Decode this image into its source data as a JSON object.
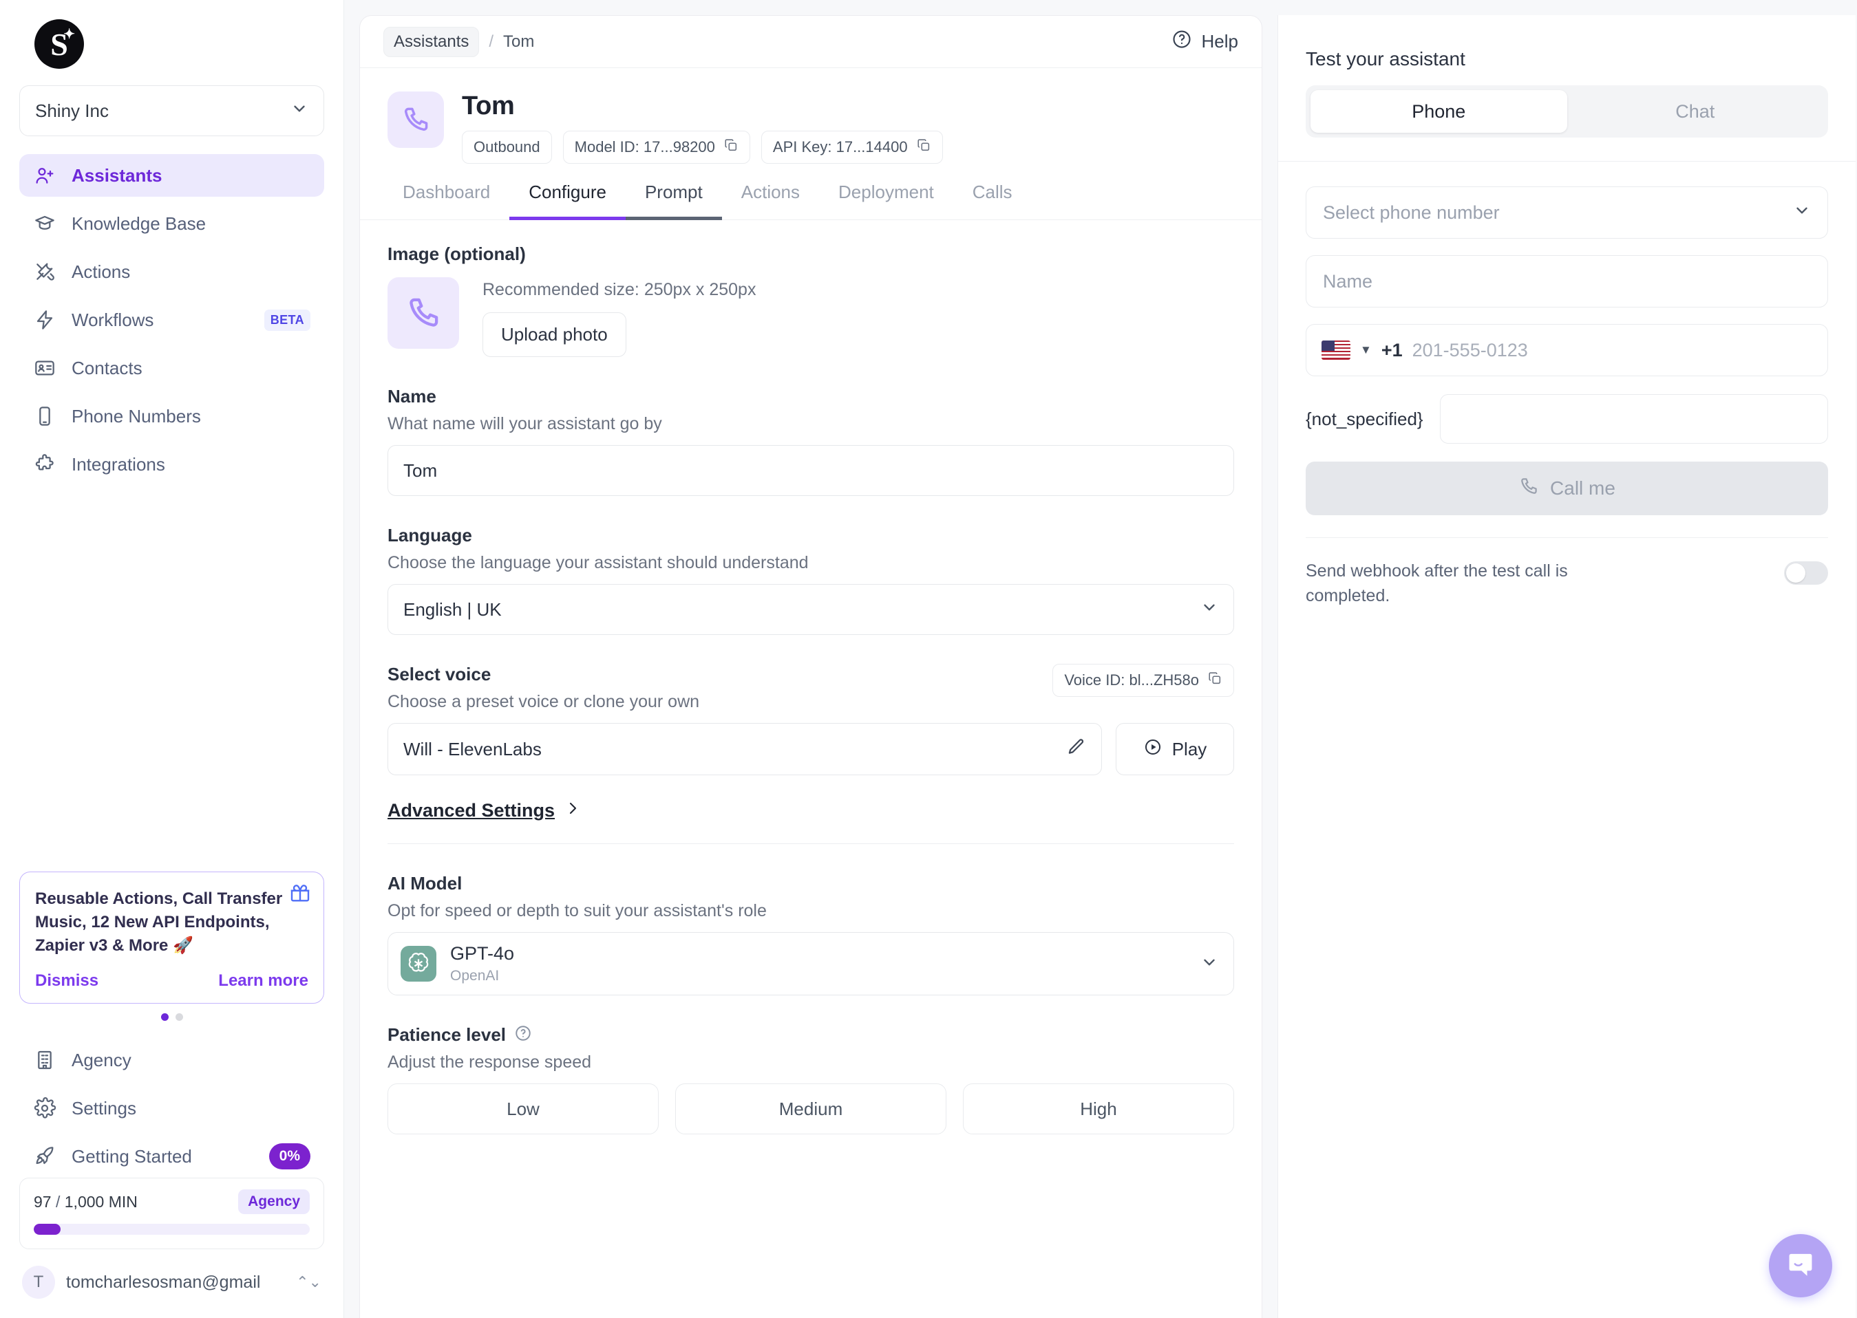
{
  "brand": {
    "logo_letter": "S",
    "accent": "#7c3aed",
    "accent_dark": "#6d28d9"
  },
  "sidebar": {
    "org": {
      "name": "Shiny Inc"
    },
    "nav": [
      {
        "label": "Assistants",
        "icon": "user-plus-icon",
        "active": true
      },
      {
        "label": "Knowledge Base",
        "icon": "graduation-cap-icon",
        "active": false
      },
      {
        "label": "Actions",
        "icon": "tools-icon",
        "active": false
      },
      {
        "label": "Workflows",
        "icon": "bolt-icon",
        "active": false,
        "badge": "BETA"
      },
      {
        "label": "Contacts",
        "icon": "contact-card-icon",
        "active": false
      },
      {
        "label": "Phone Numbers",
        "icon": "phone-device-icon",
        "active": false
      },
      {
        "label": "Integrations",
        "icon": "puzzle-icon",
        "active": false
      }
    ],
    "promo": {
      "text": "Reusable Actions, Call Transfer Music, 12 New API Endpoints, Zapier v3 & More 🚀",
      "dismiss_label": "Dismiss",
      "learn_label": "Learn more",
      "dots": 2,
      "active_dot": 0
    },
    "bottom_nav": [
      {
        "label": "Agency",
        "icon": "building-icon"
      },
      {
        "label": "Settings",
        "icon": "gear-icon"
      },
      {
        "label": "Getting Started",
        "icon": "rocket-icon",
        "badge": "0%"
      }
    ],
    "usage": {
      "used": "97",
      "separator": "/",
      "total": "1,000 MIN",
      "plan": "Agency",
      "percent": 9.7
    },
    "user": {
      "initial": "T",
      "email": "tomcharlesosman@gmail"
    }
  },
  "breadcrumb": {
    "root": "Assistants",
    "sep": "/",
    "current": "Tom",
    "help": "Help"
  },
  "assistant": {
    "name": "Tom",
    "type_chip": "Outbound",
    "model_id_chip": "Model ID: 17...98200",
    "api_key_chip": "API Key: 17...14400"
  },
  "tabs": [
    {
      "label": "Dashboard",
      "state": "idle"
    },
    {
      "label": "Configure",
      "state": "active"
    },
    {
      "label": "Prompt",
      "state": "hover"
    },
    {
      "label": "Actions",
      "state": "idle"
    },
    {
      "label": "Deployment",
      "state": "idle"
    },
    {
      "label": "Calls",
      "state": "idle"
    }
  ],
  "configure": {
    "image": {
      "label": "Image (optional)",
      "recommended": "Recommended size: 250px x 250px",
      "upload_label": "Upload photo"
    },
    "name": {
      "label": "Name",
      "hint": "What name will your assistant go by",
      "value": "Tom"
    },
    "language": {
      "label": "Language",
      "hint": "Choose the language your assistant should understand",
      "value": "English | UK"
    },
    "voice": {
      "label": "Select voice",
      "hint": "Choose a preset voice or clone your own",
      "voice_id_chip": "Voice ID: bl...ZH58o",
      "value": "Will - ElevenLabs",
      "play_label": "Play"
    },
    "advanced_label": "Advanced Settings",
    "ai_model": {
      "label": "AI Model",
      "hint": "Opt for speed or depth to suit your assistant's role",
      "value": "GPT-4o",
      "vendor": "OpenAI"
    },
    "patience": {
      "label": "Patience level",
      "hint": "Adjust the response speed",
      "options": [
        "Low",
        "Medium",
        "High"
      ]
    }
  },
  "test_panel": {
    "title": "Test your assistant",
    "modes": [
      {
        "label": "Phone",
        "selected": true
      },
      {
        "label": "Chat",
        "selected": false
      }
    ],
    "phone_select_placeholder": "Select phone number",
    "name_placeholder": "Name",
    "country_code": "+1",
    "phone_placeholder": "201-555-0123",
    "variable_name": "{not_specified}",
    "variable_value": "",
    "call_button": "Call me",
    "webhook_text": "Send webhook after the test call is completed.",
    "webhook_on": false
  }
}
